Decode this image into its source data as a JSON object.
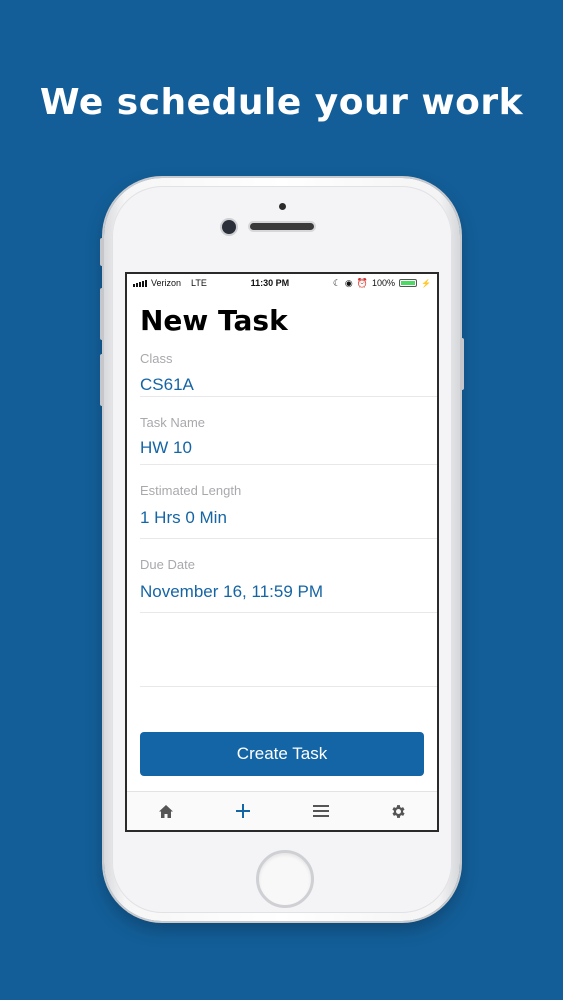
{
  "headline": "We schedule your work",
  "status_bar": {
    "carrier": "Verizon",
    "network": "LTE",
    "time": "11:30 PM",
    "battery": "100%",
    "battery_level": 1.0
  },
  "screen": {
    "title": "New Task",
    "fields": [
      {
        "label": "Class",
        "value": "CS61A"
      },
      {
        "label": "Task Name",
        "value": "HW 10"
      },
      {
        "label": "Estimated Length",
        "value": "1 Hrs 0 Min"
      },
      {
        "label": "Due Date",
        "value": "November 16, 11:59 PM"
      }
    ],
    "create_button": "Create Task"
  },
  "tabbar": {
    "items": [
      {
        "icon": "home-icon"
      },
      {
        "icon": "add-icon"
      },
      {
        "icon": "menu-icon"
      },
      {
        "icon": "settings-icon"
      }
    ]
  },
  "colors": {
    "background": "#135e98",
    "accent": "#1365a6",
    "value_text": "#1565a5",
    "label_text": "#a9a9ad"
  }
}
